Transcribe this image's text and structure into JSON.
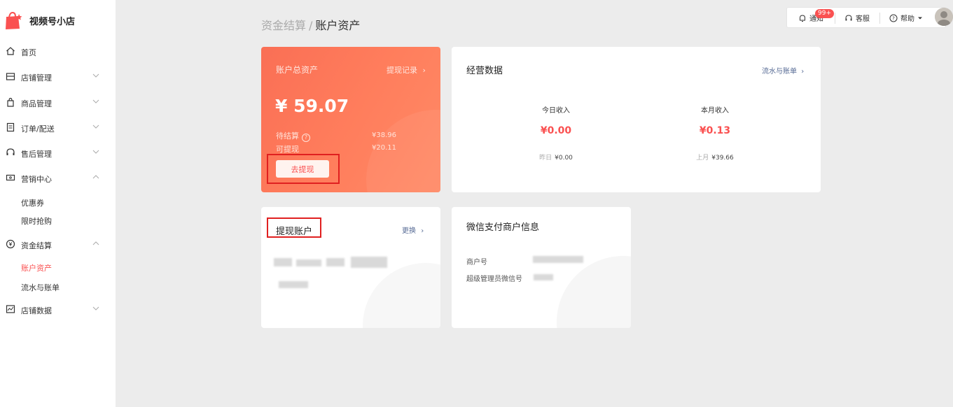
{
  "brand": {
    "name": "视频号小店",
    "accent": "#fa5151"
  },
  "sidebar": {
    "items": [
      {
        "label": "首页",
        "icon": "home-icon"
      },
      {
        "label": "店铺管理",
        "icon": "store-icon"
      },
      {
        "label": "商品管理",
        "icon": "bag-icon"
      },
      {
        "label": "订单/配送",
        "icon": "order-icon"
      },
      {
        "label": "售后管理",
        "icon": "headset-icon"
      },
      {
        "label": "营销中心",
        "icon": "coupon-icon"
      },
      {
        "label": "资金结算",
        "icon": "yen-icon"
      },
      {
        "label": "店铺数据",
        "icon": "chart-icon"
      }
    ],
    "marketing_sub": [
      "优惠券",
      "限时抢购"
    ],
    "finance_sub": [
      "账户资产",
      "流水与账单"
    ]
  },
  "breadcrumb": {
    "parent": "资金结算",
    "separator": "/",
    "current": "账户资产"
  },
  "topbar": {
    "notify_label": "通知",
    "notify_badge": "99+",
    "service_label": "客服",
    "help_label": "帮助"
  },
  "asset_card": {
    "title": "账户总资产",
    "record_link": "提现记录",
    "total": "¥ 59.07",
    "pending_label": "待结算",
    "pending_value": "¥38.96",
    "withdrawable_label": "可提现",
    "withdrawable_value": "¥20.11",
    "withdraw_button": "去提现"
  },
  "ops_card": {
    "title": "经营数据",
    "link": "流水与账单",
    "today": {
      "label": "今日收入",
      "value": "¥0.00",
      "prev_label": "昨日",
      "prev_value": "¥0.00"
    },
    "month": {
      "label": "本月收入",
      "value": "¥0.13",
      "prev_label": "上月",
      "prev_value": "¥39.66"
    }
  },
  "withdraw_account": {
    "title": "提现账户",
    "change_link": "更换"
  },
  "wechat_pay": {
    "title": "微信支付商户信息",
    "merchant_no_label": "商户号",
    "admin_label": "超级管理员微信号"
  }
}
